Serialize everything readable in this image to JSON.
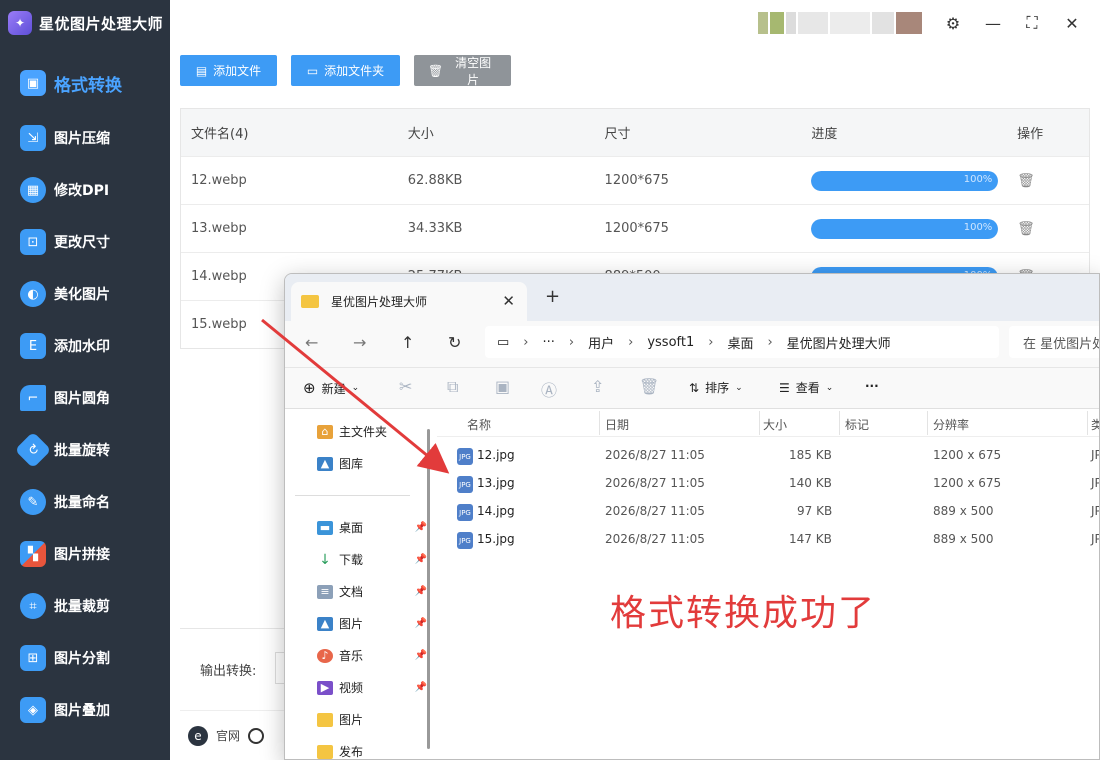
{
  "app": {
    "title": "星优图片处理大师"
  },
  "sidebar": {
    "items": [
      {
        "label": "格式转换",
        "icon": "image-convert-icon",
        "color": "#3d9bf5"
      },
      {
        "label": "图片压缩",
        "icon": "image-compress-icon",
        "color": "#3d9bf5"
      },
      {
        "label": "修改DPI",
        "icon": "dpi-icon",
        "color": "#3d9bf5"
      },
      {
        "label": "更改尺寸",
        "icon": "resize-icon",
        "color": "#3d9bf5"
      },
      {
        "label": "美化图片",
        "icon": "beautify-icon",
        "color": "#3d9bf5"
      },
      {
        "label": "添加水印",
        "icon": "watermark-icon",
        "color": "#3d9bf5"
      },
      {
        "label": "图片圆角",
        "icon": "round-corner-icon",
        "color": "#3d9bf5"
      },
      {
        "label": "批量旋转",
        "icon": "rotate-icon",
        "color": "#3d9bf5"
      },
      {
        "label": "批量命名",
        "icon": "rename-icon",
        "color": "#3d9bf5"
      },
      {
        "label": "图片拼接",
        "icon": "stitch-icon",
        "color": "#e8553c"
      },
      {
        "label": "批量裁剪",
        "icon": "crop-icon",
        "color": "#3d9bf5"
      },
      {
        "label": "图片分割",
        "icon": "split-icon",
        "color": "#3d9bf5"
      },
      {
        "label": "图片叠加",
        "icon": "overlay-icon",
        "color": "#3d9bf5"
      }
    ]
  },
  "toolbar": {
    "add_file": "添加文件",
    "add_folder": "添加文件夹",
    "clear": "清空图片"
  },
  "table": {
    "headers": [
      "文件名(4)",
      "大小",
      "尺寸",
      "进度",
      "操作"
    ],
    "rows": [
      {
        "name": "12.webp",
        "size": "62.88KB",
        "dims": "1200*675",
        "progress": 100,
        "progress_label": "100%"
      },
      {
        "name": "13.webp",
        "size": "34.33KB",
        "dims": "1200*675",
        "progress": 100,
        "progress_label": "100%"
      },
      {
        "name": "14.webp",
        "size": "25.77KB",
        "dims": "889*500",
        "progress": 100,
        "progress_label": "100%"
      },
      {
        "name": "15.webp",
        "size": "",
        "dims": "",
        "progress": 0,
        "progress_label": ""
      }
    ]
  },
  "output": {
    "label": "输出转换:"
  },
  "footer": {
    "site": "官网"
  },
  "explorer": {
    "tab_title": "星优图片处理大师",
    "address": [
      "用户",
      "yssoft1",
      "桌面",
      "星优图片处理大师"
    ],
    "search_placeholder": "在 星优图片处",
    "cmd": {
      "new": "新建",
      "sort": "排序",
      "view": "查看",
      "more": "···"
    },
    "side": {
      "top": [
        {
          "label": "主文件夹",
          "icon": "home-icon"
        },
        {
          "label": "图库",
          "icon": "gallery-icon"
        }
      ],
      "pinned": [
        {
          "label": "桌面",
          "icon": "desktop-icon",
          "pinned": true
        },
        {
          "label": "下载",
          "icon": "download-icon",
          "pinned": true
        },
        {
          "label": "文档",
          "icon": "document-icon",
          "pinned": true
        },
        {
          "label": "图片",
          "icon": "pictures-icon",
          "pinned": true
        },
        {
          "label": "音乐",
          "icon": "music-icon",
          "pinned": true
        },
        {
          "label": "视频",
          "icon": "video-icon",
          "pinned": true
        },
        {
          "label": "图片",
          "icon": "folder-icon",
          "pinned": false
        },
        {
          "label": "发布",
          "icon": "folder-icon",
          "pinned": false
        }
      ]
    },
    "list_headers": [
      "名称",
      "日期",
      "大小",
      "标记",
      "分辨率",
      "类"
    ],
    "files": [
      {
        "name": "12.jpg",
        "date": "2026/8/27 11:05",
        "size": "185 KB",
        "res": "1200 x 675",
        "type": "JP"
      },
      {
        "name": "13.jpg",
        "date": "2026/8/27 11:05",
        "size": "140 KB",
        "res": "1200 x 675",
        "type": "JP"
      },
      {
        "name": "14.jpg",
        "date": "2026/8/27 11:05",
        "size": "97 KB",
        "res": "889 x 500",
        "type": "JP"
      },
      {
        "name": "15.jpg",
        "date": "2026/8/27 11:05",
        "size": "147 KB",
        "res": "889 x 500",
        "type": "JP"
      }
    ]
  },
  "annotation": {
    "text": "格式转换成功了",
    "color": "#e23b3b"
  }
}
